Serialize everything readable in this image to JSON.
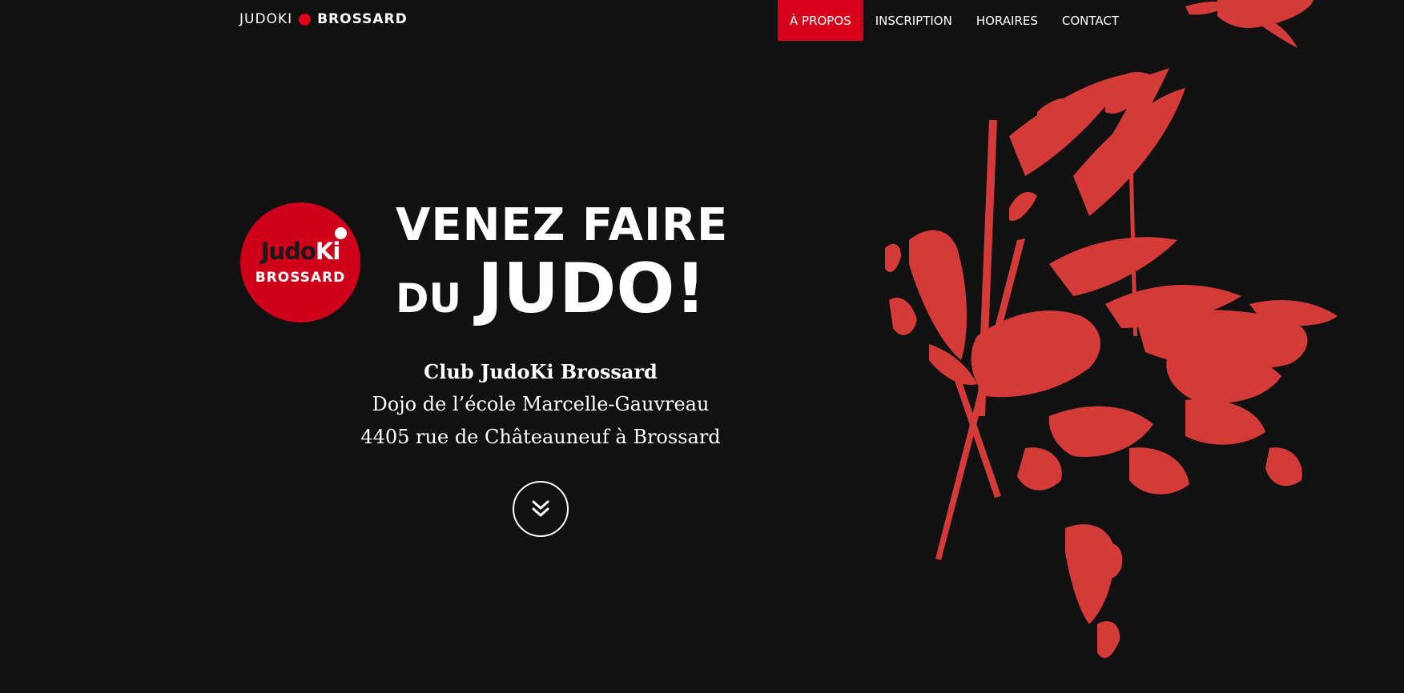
{
  "brand": {
    "light": "JUDOKI",
    "bold": "BROSSARD"
  },
  "nav": {
    "items": [
      {
        "label": "À PROPOS",
        "active": true
      },
      {
        "label": "INSCRIPTION",
        "active": false
      },
      {
        "label": "HORAIRES",
        "active": false
      },
      {
        "label": "CONTACT",
        "active": false
      }
    ]
  },
  "logo": {
    "judo": "Judo",
    "ki": "Ki",
    "brossard": "BROSSARD"
  },
  "hero": {
    "line1": "VENEZ FAIRE",
    "du": "DU",
    "judo": "JUDO!",
    "club": "Club JudoKi Brossard",
    "dojo": "Dojo de l’école Marcelle-Gauvreau",
    "street": "4405 rue de Châteauneuf à Brossard"
  },
  "icons": {
    "scroll": "double-chevron-down-icon",
    "artwork": "judo-throw-artwork"
  },
  "colors": {
    "background": "#111112",
    "accent": "#d6001b",
    "artwork": "#d43a38",
    "text": "#ffffff"
  }
}
